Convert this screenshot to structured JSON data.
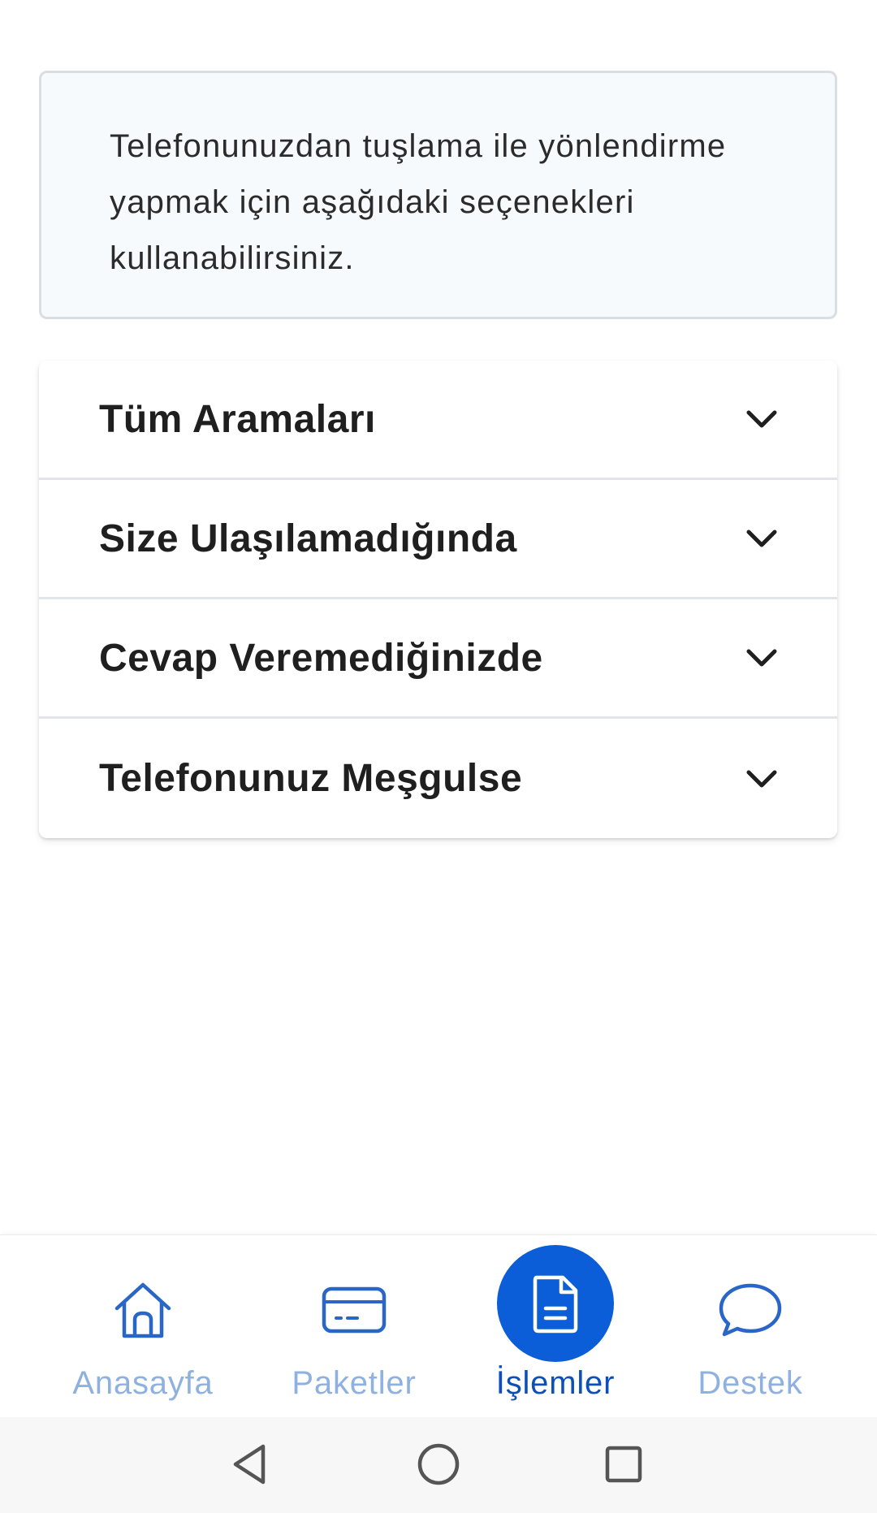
{
  "info": {
    "text": "Telefonunuzdan tuşlama ile yönlendirme yapmak için aşağıdaki seçenekleri kullanabilirsiniz."
  },
  "accordion": {
    "items": [
      {
        "label": "Tüm Aramaları",
        "icon": "chevron-down-icon"
      },
      {
        "label": "Size Ulaşılamadığında",
        "icon": "chevron-down-icon"
      },
      {
        "label": "Cevap Veremediğinizde",
        "icon": "chevron-down-icon"
      },
      {
        "label": "Telefonunuz Meşgulse",
        "icon": "chevron-down-icon"
      }
    ]
  },
  "bottom_nav": {
    "active_index": 2,
    "items": [
      {
        "label": "Anasayfa",
        "icon": "home-icon"
      },
      {
        "label": "Paketler",
        "icon": "card-icon"
      },
      {
        "label": "İşlemler",
        "icon": "document-icon"
      },
      {
        "label": "Destek",
        "icon": "chat-bubble-icon"
      }
    ]
  },
  "system_nav": {
    "buttons": [
      "back-icon",
      "home-circle-icon",
      "recents-icon"
    ]
  },
  "colors": {
    "accent": "#0b5ed7",
    "nav_inactive": "#8fb1e0",
    "nav_active_label": "#0d4fb8",
    "info_bg": "#f6fafd",
    "info_border": "#d9dee3"
  }
}
